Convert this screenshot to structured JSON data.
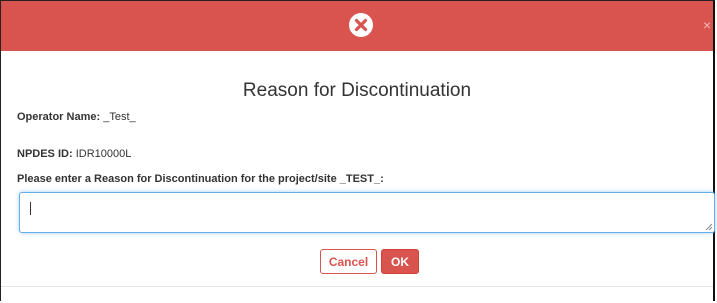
{
  "dialog": {
    "title": "Reason for Discontinuation",
    "close_glyph": "×",
    "header_color": "#d9534f",
    "header_icon": "error-x-circle-icon"
  },
  "fields": {
    "operator_label": "Operator Name:",
    "operator_value": "_Test_",
    "npdes_label": "NPDES ID:",
    "npdes_value": "IDR10000L",
    "prompt": "Please enter a Reason for Discontinuation for the project/site _TEST_:"
  },
  "reason_input": {
    "value": ""
  },
  "buttons": {
    "cancel": "Cancel",
    "ok": "OK"
  }
}
